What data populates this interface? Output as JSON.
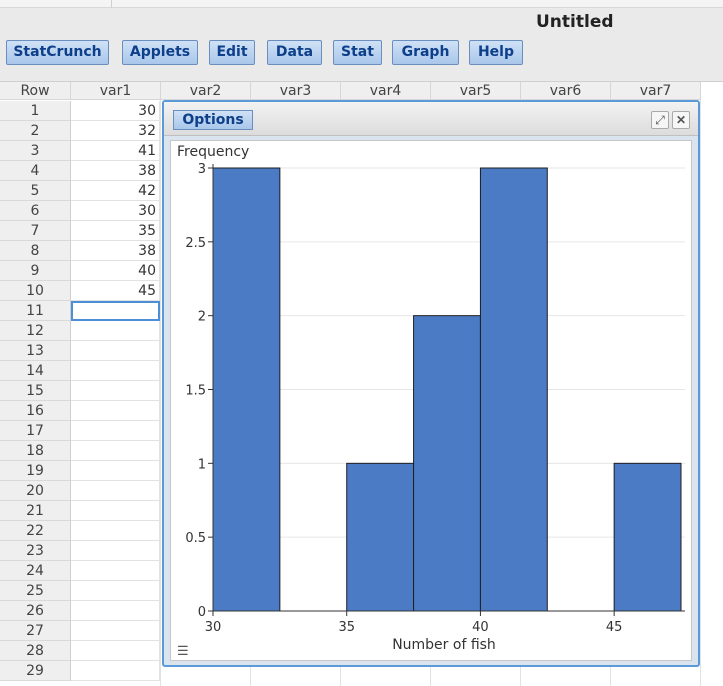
{
  "document": {
    "title": "Untitled"
  },
  "menu": [
    {
      "label": "StatCrunch",
      "name": "menu-statcrunch"
    },
    {
      "label": "Applets",
      "name": "menu-applets"
    },
    {
      "label": "Edit",
      "name": "menu-edit"
    },
    {
      "label": "Data",
      "name": "menu-data"
    },
    {
      "label": "Stat",
      "name": "menu-stat"
    },
    {
      "label": "Graph",
      "name": "menu-graph"
    },
    {
      "label": "Help",
      "name": "menu-help"
    }
  ],
  "grid": {
    "row_header": "Row",
    "columns": [
      "var1",
      "var2",
      "var3",
      "var4",
      "var5",
      "var6",
      "var7"
    ],
    "rows": [
      "1",
      "2",
      "3",
      "4",
      "5",
      "6",
      "7",
      "8",
      "9",
      "10",
      "11",
      "12",
      "13",
      "14",
      "15",
      "16",
      "17",
      "18",
      "19",
      "20",
      "21",
      "22",
      "23",
      "24",
      "25",
      "26",
      "27",
      "28",
      "29"
    ],
    "var1_values": [
      "30",
      "32",
      "41",
      "38",
      "42",
      "30",
      "35",
      "38",
      "40",
      "45"
    ]
  },
  "graph_window": {
    "options_label": "Options",
    "expand_icon": "expand-icon",
    "close_icon": "close-icon",
    "menu_icon": "hamburger-icon"
  },
  "chart_data": {
    "type": "bar",
    "bar_color": "#4a7bc4",
    "ylabel": "Frequency",
    "xlabel": "Number of fish",
    "xlim": [
      30,
      47.5
    ],
    "ylim": [
      0,
      3
    ],
    "bin_width": 2.5,
    "bins": [
      {
        "start": 30,
        "end": 32.5,
        "count": 3
      },
      {
        "start": 32.5,
        "end": 35,
        "count": 0
      },
      {
        "start": 35,
        "end": 37.5,
        "count": 1
      },
      {
        "start": 37.5,
        "end": 40,
        "count": 2
      },
      {
        "start": 40,
        "end": 42.5,
        "count": 3
      },
      {
        "start": 42.5,
        "end": 45,
        "count": 0
      },
      {
        "start": 45,
        "end": 47.5,
        "count": 1
      }
    ],
    "x_ticks": [
      "30",
      "35",
      "40",
      "45"
    ],
    "y_ticks": [
      "0",
      "0.5",
      "1",
      "1.5",
      "2",
      "2.5",
      "3"
    ]
  }
}
